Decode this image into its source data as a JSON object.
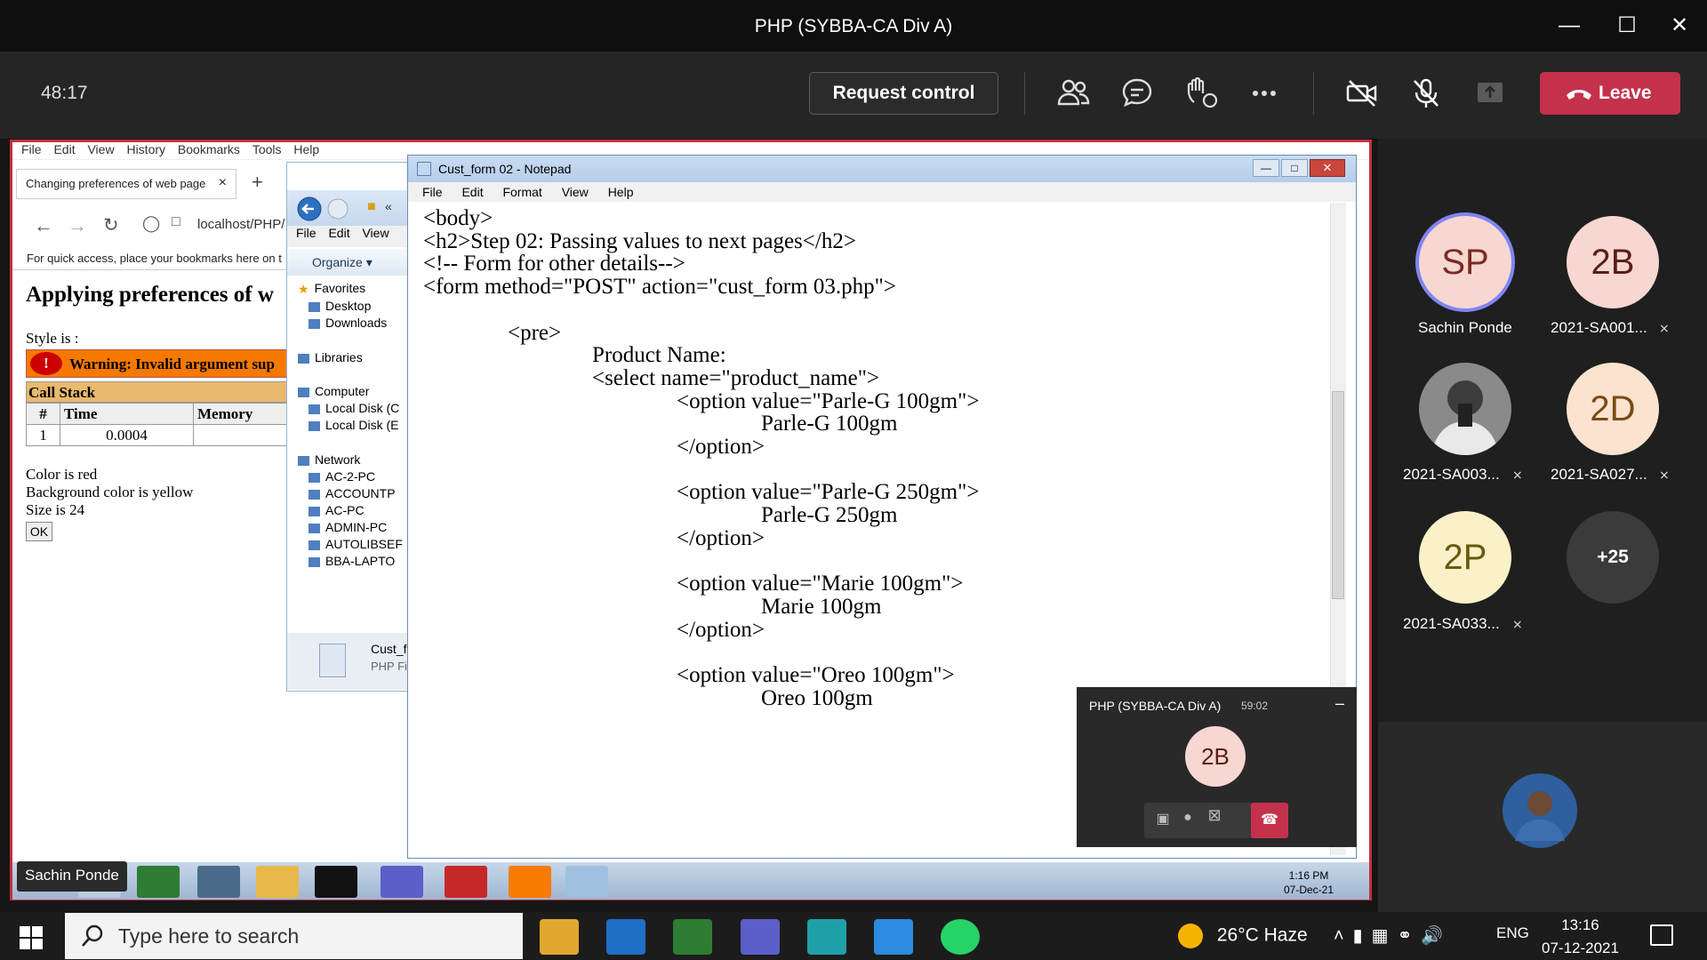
{
  "window": {
    "title": "PHP (SYBBA-CA Div A)"
  },
  "meeting": {
    "timer": "48:17",
    "request_control": "Request control",
    "leave": "Leave",
    "brand_red": "#c4314b"
  },
  "browser": {
    "menu": [
      "File",
      "Edit",
      "View",
      "History",
      "Bookmarks",
      "Tools",
      "Help"
    ],
    "tab_title": "Changing preferences of web page",
    "url": "localhost/PHP/",
    "bookmarks_hint": "For quick access, place your bookmarks here on t",
    "page_heading": "Applying preferences of w",
    "style_line": "Style is :",
    "warning_text": "Warning: Invalid argument sup",
    "warning_mark": "!",
    "call_stack": "Call Stack",
    "table": {
      "headers": [
        "#",
        "Time",
        "Memory"
      ],
      "row": [
        "1",
        "0.0004",
        ""
      ]
    },
    "color_line": "Color is red",
    "bg_line": "Background color is yellow",
    "size_line": "Size is 24",
    "ok": "OK"
  },
  "explorer": {
    "menu": [
      "File",
      "Edit",
      "View"
    ],
    "organize": "Organize ▾",
    "nav": [
      {
        "label": "Favorites",
        "icon": "star-icon"
      },
      {
        "label": "Desktop",
        "icon": "desktop-icon"
      },
      {
        "label": "Downloads",
        "icon": "downloads-icon"
      },
      {
        "label": "Libraries",
        "icon": "library-icon"
      },
      {
        "label": "Computer",
        "icon": "computer-icon"
      },
      {
        "label": "Local Disk (C",
        "icon": "disk-icon"
      },
      {
        "label": "Local Disk (E",
        "icon": "disk-icon"
      },
      {
        "label": "Network",
        "icon": "network-icon"
      },
      {
        "label": "AC-2-PC",
        "icon": "pc-icon"
      },
      {
        "label": "ACCOUNTP",
        "icon": "pc-icon"
      },
      {
        "label": "AC-PC",
        "icon": "pc-icon"
      },
      {
        "label": "ADMIN-PC",
        "icon": "pc-icon"
      },
      {
        "label": "AUTOLIBSEF",
        "icon": "pc-icon"
      },
      {
        "label": "BBA-LAPTO",
        "icon": "pc-icon"
      }
    ],
    "file_name": "Cust_fo",
    "file_type": "PHP Fi"
  },
  "notepad": {
    "title": "Cust_form 02 - Notepad",
    "menu": [
      "File",
      "Edit",
      "Format",
      "View",
      "Help"
    ],
    "lines": [
      "<body>",
      "<h2>Step 02: Passing values to next pages</h2>",
      "<!-- Form for other details-->",
      "<form method=\"POST\" action=\"cust_form 03.php\">",
      "",
      "<pre>",
      "Product Name:",
      "<select name=\"product_name\">",
      "<option value=\"Parle-G 100gm\">",
      "Parle-G 100gm",
      "</option>",
      "",
      "<option value=\"Parle-G 250gm\">",
      "Parle-G 250gm",
      "</option>",
      "",
      "<option value=\"Marie 100gm\">",
      "Marie 100gm",
      "</option>",
      "",
      "<option value=\"Oreo 100gm\">",
      "Oreo 100gm"
    ],
    "indent_levels": [
      0,
      0,
      0,
      0,
      0,
      1,
      2,
      2,
      3,
      4,
      3,
      0,
      3,
      4,
      3,
      0,
      3,
      4,
      3,
      0,
      3,
      4
    ]
  },
  "mini_call": {
    "title": "PHP (SYBBA-CA Div A)",
    "time": "59:02",
    "avatar": "2B",
    "minimize": "–"
  },
  "vm_taskbar": {
    "time": "1:16 PM",
    "date": "07-Dec-21",
    "presenter": "Sachin Ponde"
  },
  "participants": [
    {
      "initials": "SP",
      "name": "Sachin Ponde",
      "muted": false,
      "bg": "#f7d7d1",
      "fg": "#7a2b22"
    },
    {
      "initials": "2B",
      "name": "2021-SA001...",
      "muted": true,
      "bg": "#f7d7d1",
      "fg": "#5a1d17"
    },
    {
      "initials": "",
      "name": "2021-SA003...",
      "muted": true,
      "bg": "#777777",
      "fg": "#ffffff"
    },
    {
      "initials": "2D",
      "name": "2021-SA027...",
      "muted": true,
      "bg": "#fbe3cf",
      "fg": "#7a4a16"
    },
    {
      "initials": "2P",
      "name": "2021-SA033...",
      "muted": true,
      "bg": "#fbf1c8",
      "fg": "#6a5a10"
    },
    {
      "initials": "+25",
      "name": "",
      "muted": false,
      "bg": "#3b3b3b",
      "fg": "#ffffff"
    }
  ],
  "windows_taskbar": {
    "search_placeholder": "Type here to search",
    "weather": "26°C  Haze",
    "lang": "ENG",
    "time": "13:16",
    "date": "07-12-2021"
  }
}
